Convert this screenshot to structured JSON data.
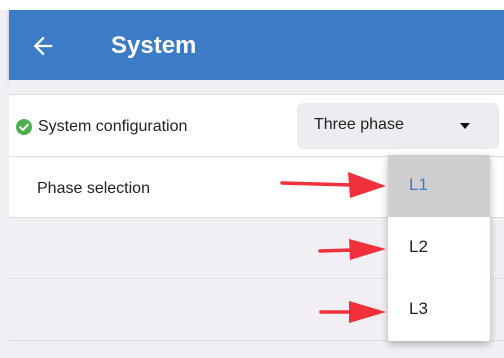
{
  "app_bar": {
    "title": "System",
    "back_icon": "arrow-left-icon",
    "color": "#3c7cc7"
  },
  "settings": {
    "system_configuration": {
      "label": "System configuration",
      "status_icon": "check-circle-icon",
      "status_color": "#4caf50",
      "selected_value": "Three phase"
    },
    "phase_selection": {
      "label": "Phase selection"
    }
  },
  "dropdown": {
    "options": [
      {
        "label": "L1",
        "selected": true
      },
      {
        "label": "L2",
        "selected": false
      },
      {
        "label": "L3",
        "selected": false
      }
    ],
    "selected_color": "#3c7cc7"
  },
  "annotation": {
    "arrow_color": "#f0313b",
    "arrow_icon": "arrow-right-icon"
  }
}
